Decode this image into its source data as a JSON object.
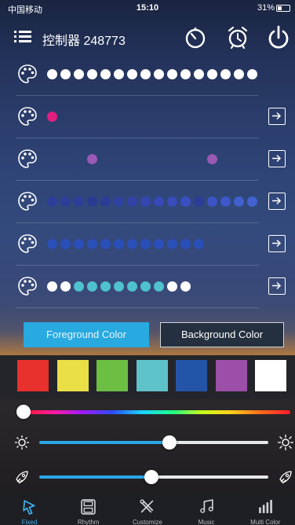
{
  "status_bar": {
    "carrier": "中国移动",
    "time": "15:10",
    "battery": "31%"
  },
  "header": {
    "title": "控制器 248773"
  },
  "rows": [
    {
      "dots": [
        "#ffffff",
        "#ffffff",
        "#ffffff",
        "#ffffff",
        "#ffffff",
        "#ffffff",
        "#ffffff",
        "#ffffff",
        "#ffffff",
        "#ffffff",
        "#ffffff",
        "#ffffff",
        "#ffffff",
        "#ffffff",
        "#ffffff",
        "#ffffff"
      ],
      "has_arrow": false
    },
    {
      "dots": [
        "#e21e7e",
        null,
        null,
        null,
        null,
        null,
        null,
        null,
        null,
        null,
        null,
        null,
        null,
        null,
        null,
        null
      ],
      "has_arrow": true
    },
    {
      "dots": [
        null,
        null,
        null,
        "#9b59b6",
        null,
        null,
        null,
        null,
        null,
        null,
        null,
        null,
        "#9b59b6",
        null,
        null,
        null
      ],
      "has_arrow": true
    },
    {
      "dots": [
        "#2c3d9a",
        "#2c3d9a",
        "#2c3d9a",
        "#283a92",
        "#2a3c96",
        "#2e40a0",
        "#3242a8",
        "#3446b0",
        "#3649b6",
        "#384cbc",
        "#3a4fc0",
        "#2a3c96",
        "#3c54c6",
        "#3e58ca",
        "#4060ce",
        "#4262d2"
      ],
      "has_arrow": true
    },
    {
      "dots": [
        "#2a4fb8",
        "#2a4fb8",
        "#2a4fb8",
        "#2a4fb8",
        "#2a4fb8",
        "#2a4fb8",
        "#2a4fb8",
        "#2a4fb8",
        "#2a4fb8",
        "#2a4fb8",
        "#2a4fb8",
        "#2a4fb8",
        null,
        null,
        null,
        null
      ],
      "has_arrow": true
    },
    {
      "dots": [
        "#ffffff",
        "#ffffff",
        "#4fc1cf",
        "#4fc1cf",
        "#4fc1cf",
        "#4fc1cf",
        "#4fc1cf",
        "#4fc1cf",
        "#4fc1cf",
        "#ffffff",
        "#ffffff",
        null,
        null,
        null,
        null,
        null
      ],
      "has_arrow": true
    }
  ],
  "color_tabs": {
    "foreground": "Foreground Color",
    "background": "Background Color"
  },
  "swatches": [
    "#e8312c",
    "#eadf45",
    "#6cbf43",
    "#5ec2c9",
    "#2454a8",
    "#9b4fa8",
    "#ffffff"
  ],
  "sliders": {
    "hue_position": 0,
    "brightness_value": 0.57,
    "speed_value": 0.49
  },
  "tabs": [
    {
      "label": "Fixed",
      "icon": "pointer-icon",
      "active": true
    },
    {
      "label": "Rhythm",
      "icon": "save-icon",
      "active": false
    },
    {
      "label": "Customize",
      "icon": "tools-icon",
      "active": false
    },
    {
      "label": "Music",
      "icon": "music-icon",
      "active": false
    },
    {
      "label": "Multi Color",
      "icon": "bars-icon",
      "active": false
    }
  ]
}
